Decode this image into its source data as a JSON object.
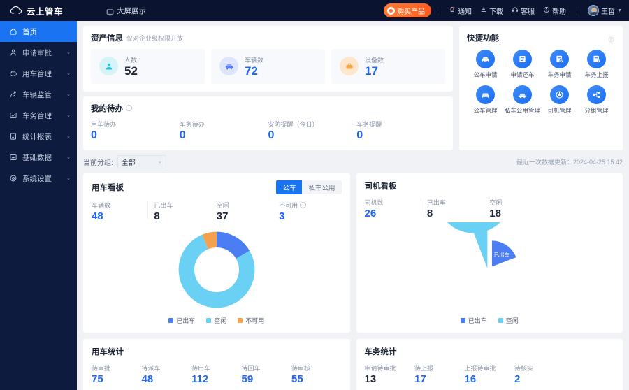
{
  "header": {
    "brand": "云上管车",
    "brand_logo_icon": "cloud-icon",
    "nav": [
      {
        "label": "大屏展示",
        "icon": "monitor-icon"
      }
    ],
    "buy_button": {
      "label": "购买产品",
      "icon": "gift-icon",
      "color": "#ff6a25"
    },
    "actions": [
      {
        "label": "通知",
        "icon": "bell-icon"
      },
      {
        "label": "下载",
        "icon": "download-icon"
      },
      {
        "label": "客服",
        "icon": "headset-icon"
      },
      {
        "label": "帮助",
        "icon": "help-circle-icon"
      }
    ],
    "user": {
      "name": "王哲",
      "avatar_icon": "avatar",
      "caret": "▼"
    }
  },
  "sidebar": {
    "items": [
      {
        "label": "首页",
        "icon": "home-icon",
        "active": true,
        "expandable": false
      },
      {
        "label": "申请审批",
        "icon": "approval-icon",
        "active": false,
        "expandable": true
      },
      {
        "label": "用车管理",
        "icon": "car-manage-icon",
        "active": false,
        "expandable": true
      },
      {
        "label": "车辆监管",
        "icon": "monitor-car-icon",
        "active": false,
        "expandable": true
      },
      {
        "label": "车务管理",
        "icon": "service-icon",
        "active": false,
        "expandable": true
      },
      {
        "label": "统计报表",
        "icon": "report-icon",
        "active": false,
        "expandable": true
      },
      {
        "label": "基础数据",
        "icon": "database-icon",
        "active": false,
        "expandable": true
      },
      {
        "label": "系统设置",
        "icon": "settings-icon",
        "active": false,
        "expandable": true
      }
    ],
    "arrow": "⌄"
  },
  "asset": {
    "title": "资产信息",
    "subtitle": "仅对企业级权限开放",
    "items": [
      {
        "label": "人数",
        "value": "52",
        "icon": "person-icon",
        "accent": "#22c3dd",
        "dark_value": true
      },
      {
        "label": "车辆数",
        "value": "72",
        "icon": "car-icon",
        "accent": "#5b7ef5",
        "dark_value": false
      },
      {
        "label": "设备数",
        "value": "17",
        "icon": "device-icon",
        "accent": "#f5a84c",
        "dark_value": false
      }
    ]
  },
  "todo": {
    "title": "我的待办",
    "info_icon": "info-icon",
    "items": [
      {
        "label": "用车待办",
        "value": "0"
      },
      {
        "label": "车务待办",
        "value": "0"
      },
      {
        "label": "安防提醒（今日）",
        "value": "0"
      },
      {
        "label": "车务提醒",
        "value": "0"
      }
    ]
  },
  "quick": {
    "title": "快捷功能",
    "settings_icon": "gear-icon",
    "items": [
      {
        "label": "公车申请",
        "icon": "car-apply-icon"
      },
      {
        "label": "申请还车",
        "icon": "return-car-icon"
      },
      {
        "label": "车务申请",
        "icon": "service-apply-icon"
      },
      {
        "label": "车务上报",
        "icon": "service-report-icon"
      },
      {
        "label": "公车管理",
        "icon": "public-car-icon"
      },
      {
        "label": "私车公用管理",
        "icon": "private-car-icon"
      },
      {
        "label": "司机管理",
        "icon": "driver-icon"
      },
      {
        "label": "分组管理",
        "icon": "group-icon"
      }
    ]
  },
  "filter": {
    "label": "当前分组:",
    "selected": "全部",
    "caret": "⌄",
    "update_text": "最近一次数据更新：2024-04-25 15:42"
  },
  "vehicle_board": {
    "title": "用车看板",
    "tabs": [
      {
        "label": "公车",
        "active": true
      },
      {
        "label": "私车公用",
        "active": false
      }
    ],
    "kpis": [
      {
        "label": "车辆数",
        "value": "48",
        "dark": false
      },
      {
        "label": "已出车",
        "value": "8",
        "dark": true
      },
      {
        "label": "空闲",
        "value": "37",
        "dark": true
      },
      {
        "label": "不可用",
        "value": "3",
        "dark": false,
        "info": true
      }
    ]
  },
  "driver_board": {
    "title": "司机看板",
    "kpis": [
      {
        "label": "司机数",
        "value": "26",
        "dark": false
      },
      {
        "label": "已出车",
        "value": "8",
        "dark": true
      },
      {
        "label": "空闲",
        "value": "18",
        "dark": true
      }
    ]
  },
  "vehicle_stats": {
    "title": "用车统计",
    "items": [
      {
        "label": "待审批",
        "value": "75",
        "dark": false
      },
      {
        "label": "待派车",
        "value": "48",
        "dark": false
      },
      {
        "label": "待出车",
        "value": "112",
        "dark": false
      },
      {
        "label": "待回车",
        "value": "59",
        "dark": false
      },
      {
        "label": "待审核",
        "value": "55",
        "dark": false
      }
    ]
  },
  "service_stats": {
    "title": "车务统计",
    "items": [
      {
        "label": "申请待审批",
        "value": "13",
        "dark": true
      },
      {
        "label": "待上报",
        "value": "17",
        "dark": false
      },
      {
        "label": "上报待审批",
        "value": "16",
        "dark": false
      },
      {
        "label": "待核实",
        "value": "2",
        "dark": false
      }
    ]
  },
  "chart_data": [
    {
      "type": "pie",
      "title": "用车看板",
      "variant": "donut",
      "categories": [
        "已出车",
        "空闲",
        "不可用"
      ],
      "values": [
        8,
        37,
        3
      ],
      "colors": [
        "#4c7ef3",
        "#6ad1f5",
        "#f5a04c"
      ],
      "legend": "bottom",
      "labels_inside": false
    },
    {
      "type": "pie",
      "title": "司机看板",
      "variant": "pie-exploded",
      "categories": [
        "已出车",
        "空闲"
      ],
      "values": [
        8,
        18
      ],
      "colors": [
        "#4c7ef3",
        "#6ad1f5"
      ],
      "legend": "bottom",
      "labels_inside": true,
      "exploded_slice": "已出车"
    }
  ]
}
